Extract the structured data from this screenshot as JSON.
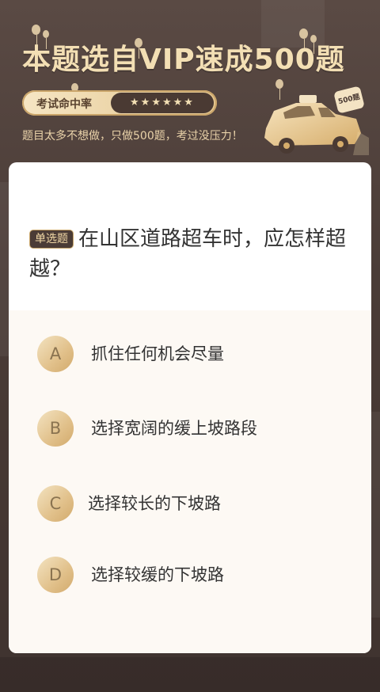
{
  "banner": {
    "title": "本题选自VIP速成500题",
    "rate_label": "考试命中率",
    "stars": "★★★★★★",
    "subtitle": "题目太多不想做，只做500题，考过没压力！",
    "badge": "500题"
  },
  "question": {
    "type": "单选题",
    "text": "在山区道路超车时，应怎样超越？",
    "options": [
      {
        "letter": "A",
        "text": "抓住任何机会尽量"
      },
      {
        "letter": "B",
        "text": "选择宽阔的缓上坡路段"
      },
      {
        "letter": "C",
        "text": "选择较长的下坡路"
      },
      {
        "letter": "D",
        "text": "选择较缓的下坡路"
      }
    ]
  },
  "colors": {
    "background": "#4a3c37",
    "accent_gold": "#e1c08a",
    "title_gold": "#f3dfb4"
  },
  "icons": [
    "balloon-icon",
    "taxi-car-icon"
  ]
}
